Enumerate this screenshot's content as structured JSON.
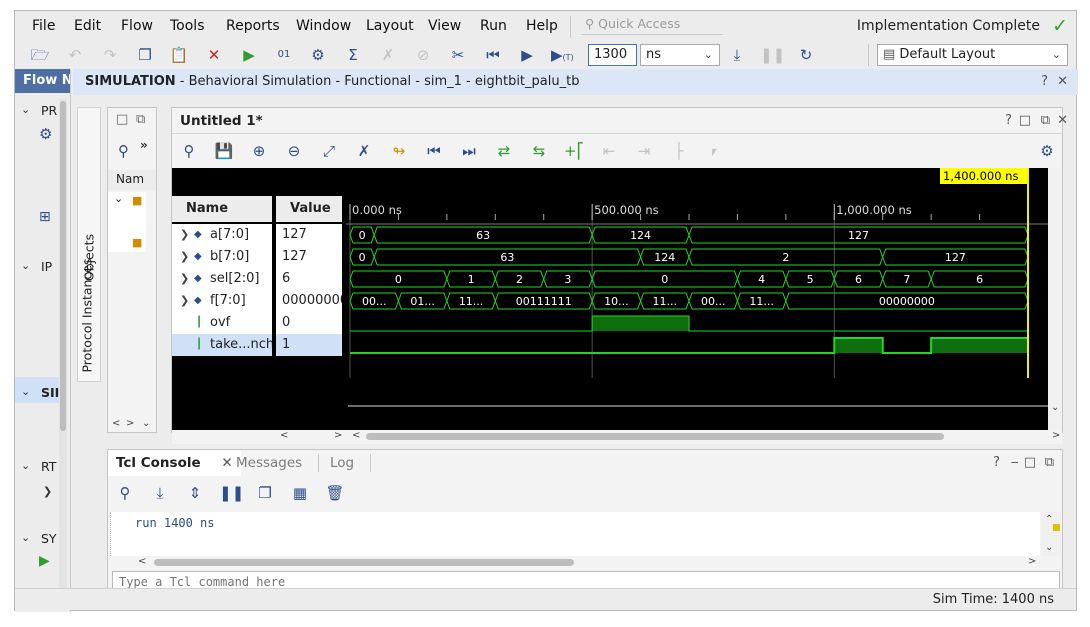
{
  "menu": [
    "File",
    "Edit",
    "Flow",
    "Tools",
    "Reports",
    "Window",
    "Layout",
    "View",
    "Run",
    "Help"
  ],
  "quick_access": "Quick Access",
  "status": "Implementation Complete",
  "toolbar": {
    "run_time_value": "1300",
    "run_time_unit": "ns",
    "layout_select": "Default Layout"
  },
  "flow_nav": {
    "title": "Flow N",
    "sections": [
      "PR",
      "IP",
      "SII",
      "RT",
      "SY"
    ]
  },
  "simulation_header": {
    "label": "SIMULATION",
    "detail": " - Behavioral Simulation - Functional - sim_1 - eightbit_palu_tb"
  },
  "objects_panel": {
    "column": "Nam",
    "vertical_tabs": [
      "Objects",
      "Protocol Instances"
    ]
  },
  "wave": {
    "title": "Untitled 1*",
    "cursor_label": "1,400.000 ns",
    "columns": {
      "name": "Name",
      "value": "Value"
    },
    "time_axis": [
      "0.000 ns",
      "500.000 ns",
      "1,000.000 ns"
    ],
    "time_scale_ns": [
      0,
      1400
    ],
    "signals": [
      {
        "name": "a[7:0]",
        "value": "127",
        "kind": "bus",
        "segments": [
          [
            0,
            50,
            "0"
          ],
          [
            50,
            500,
            "63"
          ],
          [
            500,
            700,
            "124"
          ],
          [
            700,
            1400,
            "127"
          ]
        ]
      },
      {
        "name": "b[7:0]",
        "value": "127",
        "kind": "bus",
        "segments": [
          [
            0,
            50,
            "0"
          ],
          [
            50,
            600,
            "63"
          ],
          [
            600,
            700,
            "124"
          ],
          [
            700,
            1100,
            "2"
          ],
          [
            1100,
            1400,
            "127"
          ]
        ]
      },
      {
        "name": "sel[2:0]",
        "value": "6",
        "kind": "bus",
        "segments": [
          [
            0,
            200,
            "0"
          ],
          [
            200,
            300,
            "1"
          ],
          [
            300,
            400,
            "2"
          ],
          [
            400,
            500,
            "3"
          ],
          [
            500,
            800,
            "0"
          ],
          [
            800,
            900,
            "4"
          ],
          [
            900,
            1000,
            "5"
          ],
          [
            1000,
            1100,
            "6"
          ],
          [
            1100,
            1200,
            "7"
          ],
          [
            1200,
            1400,
            "6"
          ]
        ]
      },
      {
        "name": "f[7:0]",
        "value": "00000000",
        "kind": "bus",
        "segments": [
          [
            0,
            100,
            "00..."
          ],
          [
            100,
            200,
            "01..."
          ],
          [
            200,
            300,
            "11..."
          ],
          [
            300,
            500,
            "00111111"
          ],
          [
            500,
            600,
            "10..."
          ],
          [
            600,
            700,
            "11..."
          ],
          [
            700,
            800,
            "00..."
          ],
          [
            800,
            900,
            "11..."
          ],
          [
            900,
            1400,
            "00000000"
          ]
        ]
      },
      {
        "name": "ovf",
        "value": "0",
        "kind": "bit",
        "highs": [
          [
            500,
            700
          ]
        ]
      },
      {
        "name": "take...nch",
        "value": "1",
        "kind": "bit",
        "highs": [
          [
            1000,
            1100
          ],
          [
            1200,
            1400
          ]
        ],
        "selected": true
      }
    ]
  },
  "console": {
    "tabs": [
      "Tcl Console",
      "Messages",
      "Log"
    ],
    "output": "run 1400 ns",
    "input_placeholder": "Type a Tcl command here"
  },
  "statusbar": {
    "sim_time": "Sim Time: 1400 ns"
  }
}
